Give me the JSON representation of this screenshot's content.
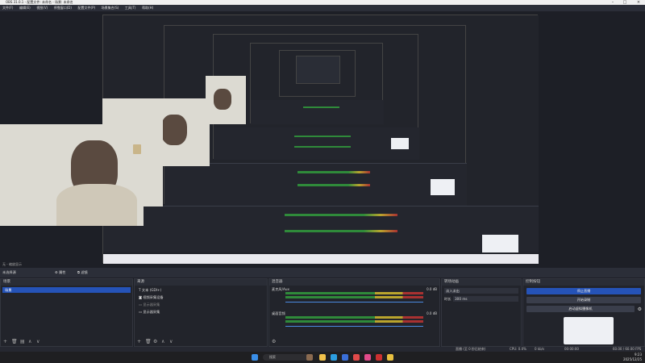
{
  "window": {
    "title": "OBS 31.0.1 - 配置文件: 未命名 - 场景: 未命名"
  },
  "menu": [
    "文件(F)",
    "编辑(E)",
    "视图(V)",
    "停靠窗口(D)",
    "配置文件(P)",
    "场景集合(S)",
    "工具(T)",
    "帮助(H)"
  ],
  "scene_bar": {
    "status": "无 - 缩放显示",
    "no_source": "未选择源",
    "properties": "属性",
    "filters": "滤镜"
  },
  "scenes": {
    "title": "场景",
    "items": [
      "场景"
    ]
  },
  "sources": {
    "title": "来源",
    "items": [
      "文本 (GDI+)",
      "视频采集设备",
      "显示器采集",
      "显示器采集"
    ]
  },
  "mixer": {
    "title": "混音器",
    "channels": [
      {
        "name": "麦克风/Aux",
        "db": "0.0 dB"
      },
      {
        "name": "桌面音频",
        "db": "0.0 dB"
      }
    ]
  },
  "transitions": {
    "title": "转场动画",
    "type": "淡入淡出",
    "duration_label": "时长",
    "duration_value": "300 ms"
  },
  "controls": {
    "title": "控制按钮",
    "buttons": [
      "停止直播",
      "开始录制",
      "启动虚拟摄像机"
    ]
  },
  "status": {
    "recording": "00:00:00",
    "cpu": "CPU: 0.0%",
    "fps": "60.00 / 60.00 FPS",
    "dropped": "丢帧 0 (0.0%)",
    "kbps": "0 kb/s",
    "live": "直播 (至 0 秒后结束)"
  },
  "taskbar": {
    "search": "搜索",
    "time": "9:23",
    "date": "2025/12/25"
  },
  "colors": {
    "accent": "#2553b8",
    "meter_green": "#2f8a3a",
    "meter_yellow": "#b9a42d",
    "meter_red": "#a83131"
  }
}
